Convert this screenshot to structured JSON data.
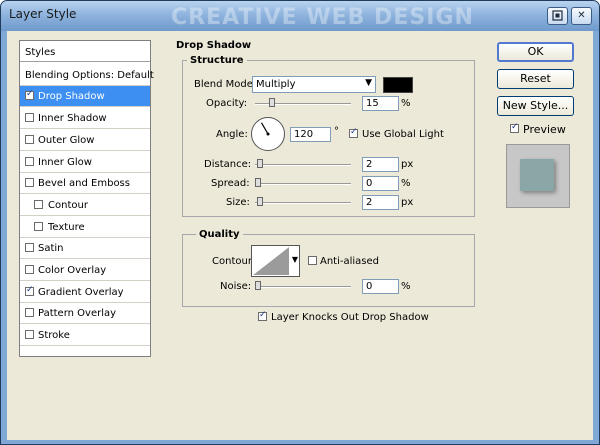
{
  "window": {
    "title": "Layer Style",
    "watermark": "CREATIVE WEB DESIGN",
    "help_icon": "help-icon",
    "close_icon": "close-icon"
  },
  "styles_list": [
    {
      "label": "Styles",
      "checkbox": false,
      "checked": false,
      "selected": false,
      "indent": false,
      "kind": "head"
    },
    {
      "label": "Blending Options: Default",
      "checkbox": false,
      "checked": false,
      "selected": false,
      "indent": false,
      "kind": "head"
    },
    {
      "label": "Drop Shadow",
      "checkbox": true,
      "checked": true,
      "selected": true,
      "indent": false
    },
    {
      "label": "Inner Shadow",
      "checkbox": true,
      "checked": false,
      "selected": false,
      "indent": false
    },
    {
      "label": "Outer Glow",
      "checkbox": true,
      "checked": false,
      "selected": false,
      "indent": false
    },
    {
      "label": "Inner Glow",
      "checkbox": true,
      "checked": false,
      "selected": false,
      "indent": false
    },
    {
      "label": "Bevel and Emboss",
      "checkbox": true,
      "checked": false,
      "selected": false,
      "indent": false
    },
    {
      "label": "Contour",
      "checkbox": true,
      "checked": false,
      "selected": false,
      "indent": true
    },
    {
      "label": "Texture",
      "checkbox": true,
      "checked": false,
      "selected": false,
      "indent": true
    },
    {
      "label": "Satin",
      "checkbox": true,
      "checked": false,
      "selected": false,
      "indent": false
    },
    {
      "label": "Color Overlay",
      "checkbox": true,
      "checked": false,
      "selected": false,
      "indent": false
    },
    {
      "label": "Gradient Overlay",
      "checkbox": true,
      "checked": true,
      "selected": false,
      "indent": false
    },
    {
      "label": "Pattern Overlay",
      "checkbox": true,
      "checked": false,
      "selected": false,
      "indent": false
    },
    {
      "label": "Stroke",
      "checkbox": true,
      "checked": false,
      "selected": false,
      "indent": false
    }
  ],
  "panel": {
    "title": "Drop Shadow",
    "structure": {
      "title": "Structure",
      "blend_mode_label": "Blend Mode:",
      "blend_mode_value": "Multiply",
      "shadow_color": "#000000",
      "opacity_label": "Opacity:",
      "opacity_value": "15",
      "opacity_unit": "%",
      "opacity_fraction": 0.15,
      "angle_label": "Angle:",
      "angle_value": "120",
      "angle_degrees": 120,
      "angle_unit": "°",
      "use_global_light_label": "Use Global Light",
      "use_global_light_checked": true,
      "distance_label": "Distance:",
      "distance_value": "2",
      "distance_unit": "px",
      "distance_fraction": 0.02,
      "spread_label": "Spread:",
      "spread_value": "0",
      "spread_unit": "%",
      "spread_fraction": 0.0,
      "size_label": "Size:",
      "size_value": "2",
      "size_unit": "px",
      "size_fraction": 0.02
    },
    "quality": {
      "title": "Quality",
      "contour_label": "Contour:",
      "anti_aliased_label": "Anti-aliased",
      "anti_aliased_checked": false,
      "noise_label": "Noise:",
      "noise_value": "0",
      "noise_unit": "%",
      "noise_fraction": 0.0
    },
    "knockout_label": "Layer Knocks Out Drop Shadow",
    "knockout_checked": true
  },
  "buttons": {
    "ok": "OK",
    "reset": "Reset",
    "new_style": "New Style...",
    "preview_label": "Preview",
    "preview_checked": true
  },
  "colors": {
    "selection": "#3d8ff2",
    "dialog_bg": "#ece9d8",
    "preview_swatch": "#8aa6a6"
  }
}
